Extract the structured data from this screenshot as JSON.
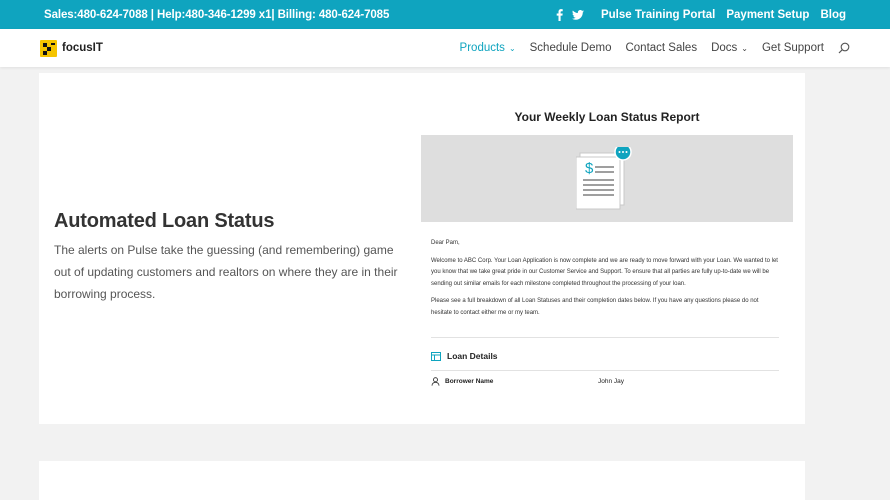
{
  "topbar": {
    "contact": "Sales:480-624-7088 | Help:480-346-1299 x1| Billing: 480-624-7085",
    "social_icons": [
      "facebook-icon",
      "twitter-icon"
    ],
    "links": [
      "Pulse Training Portal",
      "Payment Setup",
      "Blog"
    ],
    "background": "#0fa4bf"
  },
  "nav": {
    "logo_text": "focusIT",
    "items": [
      {
        "label": "Products",
        "dropdown": true,
        "active": true
      },
      {
        "label": "Schedule Demo",
        "dropdown": false,
        "active": false
      },
      {
        "label": "Contact Sales",
        "dropdown": false,
        "active": false
      },
      {
        "label": "Docs",
        "dropdown": true,
        "active": false
      },
      {
        "label": "Get Support",
        "dropdown": false,
        "active": false
      }
    ],
    "search_icon": "search-icon",
    "accent": "#0fa4bf"
  },
  "feature": {
    "title": "Automated Loan Status",
    "description": "The alerts on Pulse take the guessing (and remembering) game out of updating customers and realtors on where they are in their borrowing process."
  },
  "email": {
    "title": "Your Weekly Loan Status Report",
    "banner_icon": "document-dollar-icon",
    "greeting": "Dear Pam,",
    "paragraph1": "Welcome to ABC Corp. Your Loan Application is now complete and we are ready to move forward with your Loan. We wanted to let you know that we take great pride in our Customer Service and Support. To ensure that all parties are fully up-to-date we will be sending out similar emails for each milestone completed throughout the processing of your loan.",
    "paragraph2": "Please see a full breakdown of all Loan Statuses and their completion dates below. If you have any questions please do not hesitate to contact either me or my team.",
    "section_title": "Loan Details",
    "rows": [
      {
        "label": "Borrower Name",
        "value": "John Jay"
      }
    ]
  }
}
